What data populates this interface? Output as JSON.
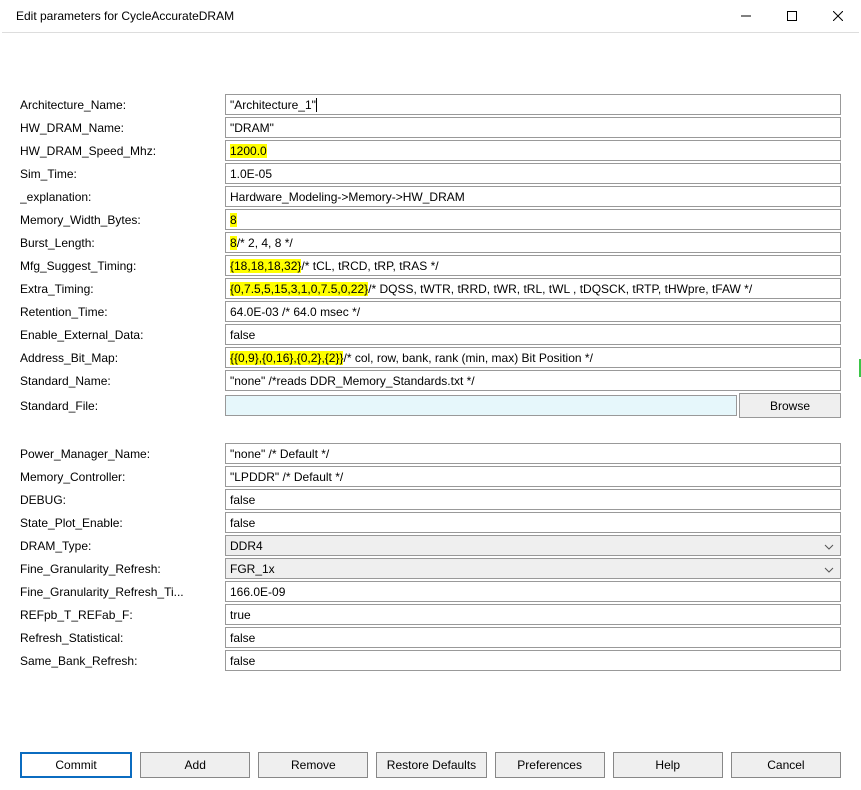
{
  "window": {
    "title": "Edit parameters for CycleAccurateDRAM"
  },
  "rows": [
    {
      "label": "Architecture_Name:",
      "type": "text",
      "value": "\"Architecture_1\"",
      "hl": false,
      "cursor": true
    },
    {
      "label": "HW_DRAM_Name:",
      "type": "text",
      "value": "\"DRAM\"",
      "hl": false
    },
    {
      "label": "HW_DRAM_Speed_Mhz:",
      "type": "text",
      "value": "1200.0",
      "hl": true,
      "hl_all": true
    },
    {
      "label": "Sim_Time:",
      "type": "text",
      "value": "1.0E-05",
      "hl": false
    },
    {
      "label": "_explanation:",
      "type": "text",
      "value": "Hardware_Modeling->Memory->HW_DRAM",
      "hl": false
    },
    {
      "label": "Memory_Width_Bytes:",
      "type": "text",
      "value": "8",
      "hl": true,
      "hl_all": true
    },
    {
      "label": "Burst_Length:",
      "type": "text",
      "hl": true,
      "hl_part": "8",
      "rest": " /* 2, 4, 8 */"
    },
    {
      "label": "Mfg_Suggest_Timing:",
      "type": "text",
      "hl": true,
      "hl_part": "{18,18,18,32}",
      "rest": " /* tCL, tRCD, tRP, tRAS */"
    },
    {
      "label": "Extra_Timing:",
      "type": "text",
      "hl": true,
      "hl_part": "{0,7.5,5,15,3,1,0,7.5,0,22}",
      "rest": " /* DQSS, tWTR, tRRD, tWR, tRL, tWL , tDQSCK, tRTP, tHWpre, tFAW */"
    },
    {
      "label": "Retention_Time:",
      "type": "text",
      "value": "64.0E-03 /* 64.0 msec */",
      "hl": false
    },
    {
      "label": "Enable_External_Data:",
      "type": "text",
      "value": "false",
      "hl": false
    },
    {
      "label": "Address_Bit_Map:",
      "type": "text",
      "hl": true,
      "hl_part": "{{0,9},{0,16},{0,2},{2}}",
      "rest": " /* col, row, bank, rank (min, max) Bit Position */"
    },
    {
      "label": "Standard_Name:",
      "type": "text",
      "value": "\"none\" /*reads DDR_Memory_Standards.txt */",
      "hl": false
    },
    {
      "label": "Standard_File:",
      "type": "file",
      "value": "",
      "button": "Browse"
    },
    {
      "label": "",
      "type": "spacer"
    },
    {
      "label": "Power_Manager_Name:",
      "type": "text",
      "value": "\"none\"  /* Default */",
      "hl": false
    },
    {
      "label": "Memory_Controller:",
      "type": "text",
      "value": "\"LPDDR\"  /* Default */",
      "hl": false
    },
    {
      "label": "DEBUG:",
      "type": "text",
      "value": "false",
      "hl": false
    },
    {
      "label": "State_Plot_Enable:",
      "type": "text",
      "value": "false",
      "hl": false
    },
    {
      "label": "DRAM_Type:",
      "type": "select",
      "value": "DDR4"
    },
    {
      "label": "Fine_Granularity_Refresh:",
      "type": "select",
      "value": "FGR_1x"
    },
    {
      "label": "Fine_Granularity_Refresh_Ti...",
      "type": "text",
      "value": "166.0E-09",
      "hl": false
    },
    {
      "label": "REFpb_T_REFab_F:",
      "type": "text",
      "value": "true",
      "hl": false
    },
    {
      "label": "Refresh_Statistical:",
      "type": "text",
      "value": "false",
      "hl": false
    },
    {
      "label": "Same_Bank_Refresh:",
      "type": "text",
      "value": "false",
      "hl": false
    }
  ],
  "buttons": {
    "commit": "Commit",
    "add": "Add",
    "remove": "Remove",
    "restore": "Restore Defaults",
    "prefs": "Preferences",
    "help": "Help",
    "cancel": "Cancel"
  }
}
